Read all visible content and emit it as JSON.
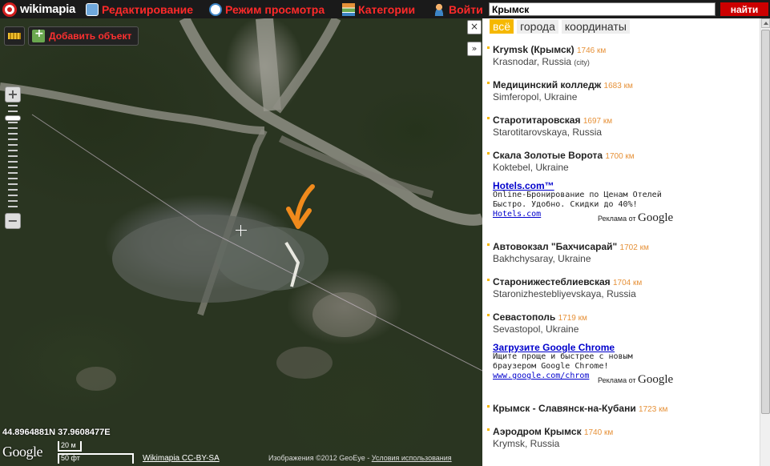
{
  "topbar": {
    "logo_text": "wikimapia",
    "nav": {
      "edit": "Редактирование",
      "view": "Режим просмотра",
      "categories": "Категории",
      "login": "Войти"
    },
    "search": {
      "value": "Крымск",
      "button": "найти"
    }
  },
  "map": {
    "add_object": "Добавить объект",
    "zoom_in": "+",
    "zoom_out": "−",
    "coords": "44.8964881N 37.9608477E",
    "google": "Google",
    "scale_metric": "20 м",
    "scale_imperial": "50 фт",
    "license": "Wikimapia CC-BY-SA",
    "imagery": "Изображения ©2012 GeoEye -",
    "terms": "Условия использования"
  },
  "panel": {
    "close": "×",
    "collapse": "»",
    "tabs": [
      "всё",
      "города",
      "координаты"
    ],
    "results": [
      {
        "title": "Krymsk (Крымск)",
        "dist": "1746 км",
        "place": "Krasnodar, Russia",
        "tag": "(city)"
      },
      {
        "title": "Медицинский колледж",
        "dist": "1683 км",
        "place": "Simferopol, Ukraine"
      },
      {
        "title": "Старотитаровская",
        "dist": "1697 км",
        "place": "Starotitarovskaya, Russia"
      },
      {
        "title": "Скала Золотые Ворота",
        "dist": "1700 км",
        "place": "Koktebel, Ukraine"
      },
      {
        "title": "Автовокзал \"Бахчисарай\"",
        "dist": "1702 км",
        "place": "Bakhchysaray, Ukraine"
      },
      {
        "title": "Старонижестеблиевская",
        "dist": "1704 км",
        "place": "Staronizhestebliyevskaya, Russia"
      },
      {
        "title": "Севастополь",
        "dist": "1719 км",
        "place": "Sevastopol, Ukraine"
      },
      {
        "title": "Крымск - Славянск-на-Кубани",
        "dist": "1723 км",
        "place": ""
      },
      {
        "title": "Аэродром Крымск",
        "dist": "1740 км",
        "place": "Krymsk, Russia"
      }
    ],
    "ads": [
      {
        "title": "Hotels.com™",
        "text": "Online-Бронирование по Ценам Отелей Быстро. Удобно. Скидки до 40%!",
        "url": "Hotels.com",
        "label": "Реклама от",
        "brand": "Google"
      },
      {
        "title": "Загрузите Google Chrome",
        "text": "Ищите проще и быстрее с новым браузером Google Chrome!",
        "url": "www.google.com/chrom",
        "label": "Реклама от",
        "brand": "Google"
      }
    ]
  },
  "colors": {
    "nav_red": "#ff2a2a",
    "search_button": "#cc0000",
    "tab_active": "#f5b800",
    "distance": "#e69138",
    "ad_link": "#0000cc"
  }
}
